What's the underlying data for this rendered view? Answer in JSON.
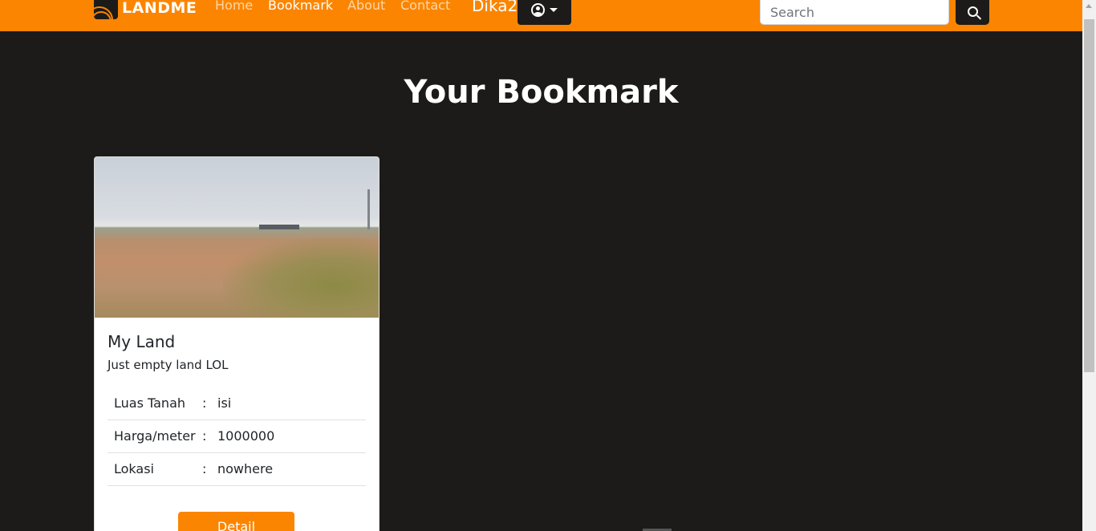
{
  "navbar": {
    "brand": "LANDME",
    "links": [
      {
        "label": "Home"
      },
      {
        "label": "Bookmark"
      },
      {
        "label": "About"
      },
      {
        "label": "Contact"
      }
    ],
    "username": "Dika2",
    "search": {
      "placeholder": "Search",
      "value": ""
    }
  },
  "main": {
    "title": "Your Bookmark",
    "cards": [
      {
        "title": "My Land",
        "description": "Just empty land LOL",
        "details": [
          {
            "label": "Luas Tanah",
            "sep": ":",
            "value": "isi"
          },
          {
            "label": "Harga/meter",
            "sep": ":",
            "value": "1000000"
          },
          {
            "label": "Lokasi",
            "sep": ":",
            "value": "nowhere"
          }
        ],
        "button_label": "Detail"
      }
    ]
  },
  "colors": {
    "accent": "#fb8500",
    "background": "#1c1b19"
  },
  "icons": {
    "user": "user-circle-icon",
    "caret": "chevron-down-icon",
    "search": "search-icon",
    "logo": "landme-logo"
  }
}
